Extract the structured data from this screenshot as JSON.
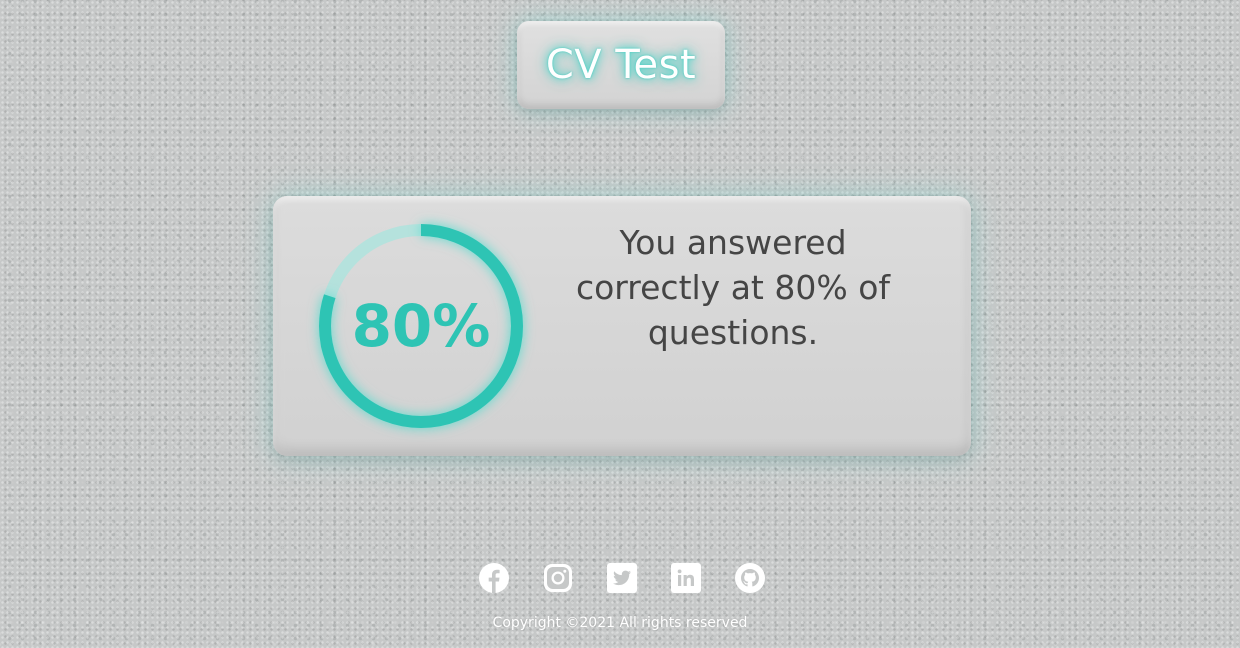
{
  "header": {
    "title": "CV Test"
  },
  "result": {
    "score_percent": 80,
    "score_label": "80%",
    "message": "You answered correctly at 80% of questions."
  },
  "footer": {
    "social_links": [
      {
        "name": "facebook",
        "icon": "facebook-icon"
      },
      {
        "name": "instagram",
        "icon": "instagram-icon"
      },
      {
        "name": "twitter",
        "icon": "twitter-icon"
      },
      {
        "name": "linkedin",
        "icon": "linkedin-icon"
      },
      {
        "name": "github",
        "icon": "github-icon"
      }
    ],
    "copyright": "Copyright ©2021 All rights reserved"
  },
  "colors": {
    "accent": "#2ec4b4",
    "ring_track": "#a8e4de",
    "text_dark": "#454545",
    "background": "#c6c8c8"
  }
}
